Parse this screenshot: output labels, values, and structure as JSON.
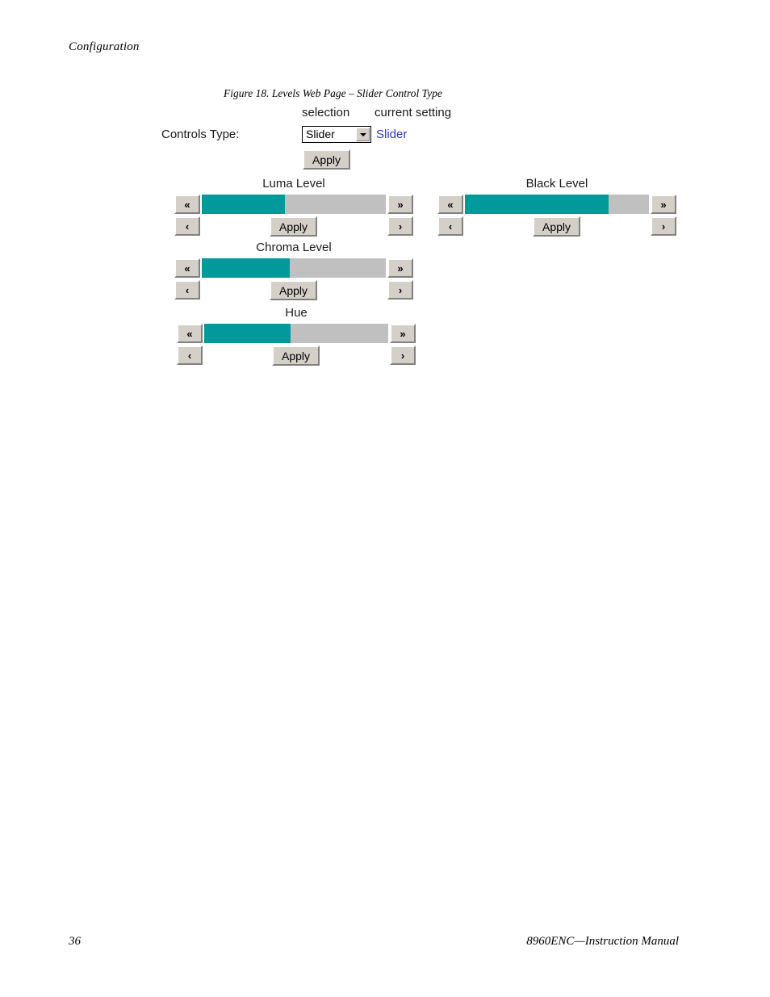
{
  "page": {
    "running_head": "Configuration",
    "footer_page_number": "36",
    "footer_title": "8960ENC—Instruction Manual"
  },
  "figure": {
    "caption": "Figure 18.  Levels Web Page – Slider Control Type"
  },
  "webpage": {
    "column_headers": {
      "selection": "selection",
      "current_setting": "current setting"
    },
    "controls_type": {
      "label": "Controls Type:",
      "selected_option": "Slider",
      "options": [
        "Slider"
      ],
      "current_setting": "Slider",
      "apply_label": "Apply",
      "dropdown_icon": "chevron-down-icon",
      "link_color": "#3333cc"
    },
    "slider_colors": {
      "fill": "#009a9a",
      "track": "#c0c0c0",
      "button_face": "#d4d0c8"
    },
    "button_labels": {
      "fast_prev": "«",
      "fast_next": "»",
      "prev": "‹",
      "next": "›",
      "apply": "Apply"
    },
    "sliders": [
      {
        "name": "luma-level",
        "title": "Luma Level",
        "fill_percent": 45
      },
      {
        "name": "black-level",
        "title": "Black Level",
        "fill_percent": 78
      },
      {
        "name": "chroma-level",
        "title": "Chroma Level",
        "fill_percent": 48
      },
      {
        "name": "hue",
        "title": "Hue",
        "fill_percent": 47
      }
    ]
  }
}
